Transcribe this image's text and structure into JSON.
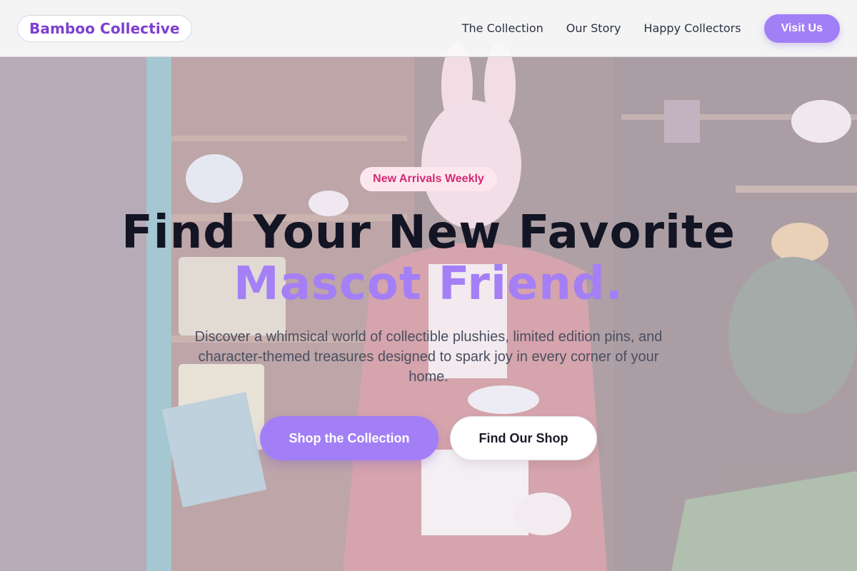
{
  "colors": {
    "brand": "#7e3fd2",
    "accent": "#a47ff6",
    "badge_bg": "#fce7ef",
    "badge_text": "#d42a73",
    "heading": "#131524"
  },
  "header": {
    "logo": "Bamboo Collective",
    "nav": [
      {
        "label": "The Collection"
      },
      {
        "label": "Our Story"
      },
      {
        "label": "Happy Collectors"
      }
    ],
    "cta_label": "Visit Us"
  },
  "hero": {
    "badge": "New Arrivals Weekly",
    "title_line1": "Find Your New Favorite",
    "title_line2": "Mascot Friend.",
    "description": "Discover a whimsical world of collectible plushies, limited edition pins, and character-themed treasures designed to spark joy in every corner of your home.",
    "primary_button": "Shop the Collection",
    "secondary_button": "Find Our Shop"
  },
  "background": {
    "icon": "rabbit-mascot-shop-photo"
  }
}
